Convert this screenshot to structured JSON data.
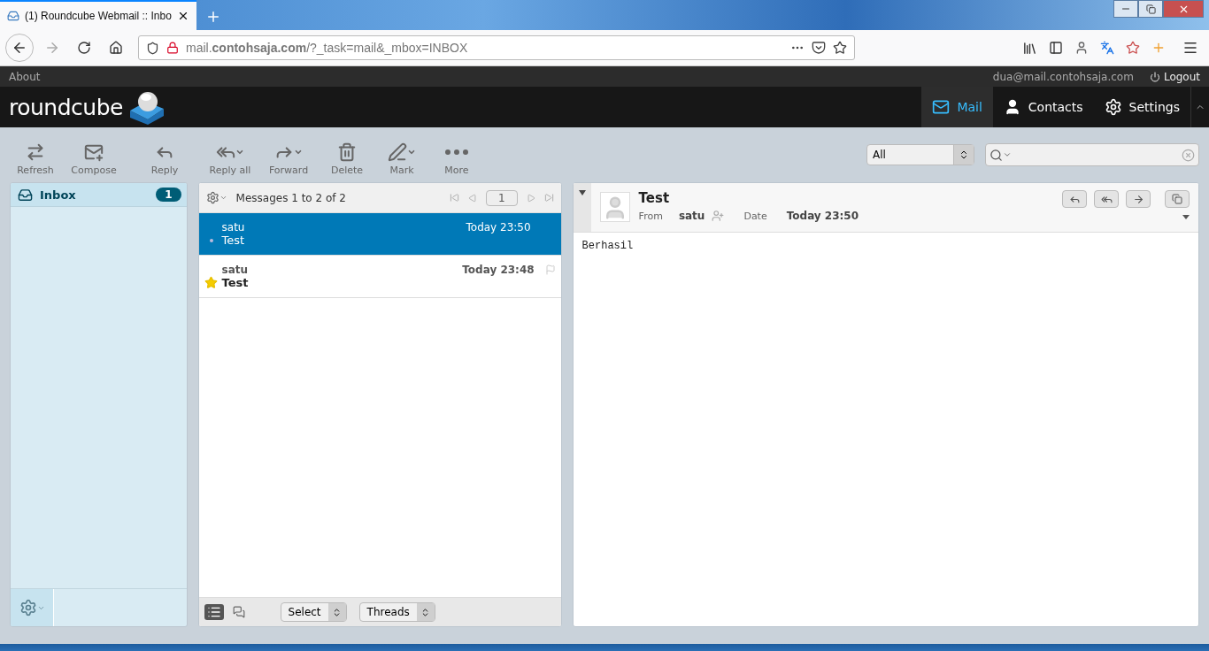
{
  "browser": {
    "tab": {
      "title": "(1) Roundcube Webmail :: Inbo",
      "selected": true
    },
    "url": "mail.**contohsaja.com**/?_task=mail&_mbox=INBOX"
  },
  "topline": {
    "about": "About",
    "user": "dua@mail.contohsaja.com",
    "logout": "Logout"
  },
  "header": {
    "logo": "roundcube",
    "nav": [
      {
        "kind": "mail",
        "label": "Mail",
        "selected": true
      },
      {
        "kind": "contacts",
        "label": "Contacts",
        "selected": false
      },
      {
        "kind": "settings",
        "label": "Settings",
        "selected": false
      }
    ]
  },
  "toolbar": [
    {
      "kind": "refresh",
      "label": "Refresh",
      "menu": false
    },
    {
      "kind": "compose",
      "label": "Compose",
      "menu": false
    },
    {
      "kind": "reply",
      "label": "Reply",
      "menu": false
    },
    {
      "kind": "replyall",
      "label": "Reply all",
      "menu": true
    },
    {
      "kind": "forward",
      "label": "Forward",
      "menu": true
    },
    {
      "kind": "delete",
      "label": "Delete",
      "menu": false
    },
    {
      "kind": "mark",
      "label": "Mark",
      "menu": true
    },
    {
      "kind": "more",
      "label": "More",
      "menu": false
    }
  ],
  "filter": {
    "value": "All"
  },
  "folders": [
    {
      "name": "Inbox",
      "unread": "1",
      "selected": true
    }
  ],
  "list": {
    "header": "Messages 1 to 2 of 2",
    "page": "1",
    "messages": [
      {
        "from": "satu",
        "date": "Today 23:50",
        "subject": "Test",
        "selected": true,
        "unread": false
      },
      {
        "from": "satu",
        "date": "Today 23:48",
        "subject": "Test",
        "selected": false,
        "unread": true
      }
    ],
    "select": "Select",
    "threads": "Threads"
  },
  "preview": {
    "subject": "Test",
    "from_label": "From",
    "from": "satu",
    "date_label": "Date",
    "date": "Today 23:50",
    "body": "Berhasil"
  }
}
